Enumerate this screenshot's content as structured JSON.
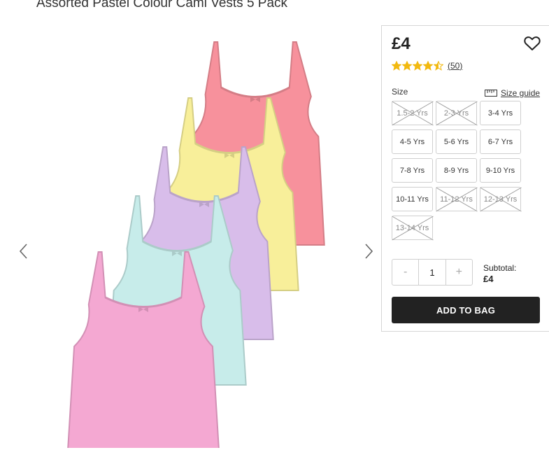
{
  "product": {
    "title": "Assorted Pastel Colour Cami Vests 5 Pack",
    "price": "£4",
    "rating": {
      "value": 4.5,
      "max": 5,
      "count": "50"
    },
    "vest_colors": [
      "#f7919c",
      "#f8ef9a",
      "#d8bdea",
      "#c7ecea",
      "#f4a8d2"
    ]
  },
  "size": {
    "label": "Size",
    "guide_label": "Size guide",
    "options": [
      {
        "label": "1.5-2 Yrs",
        "available": false
      },
      {
        "label": "2-3 Yrs",
        "available": false
      },
      {
        "label": "3-4 Yrs",
        "available": true
      },
      {
        "label": "4-5 Yrs",
        "available": true
      },
      {
        "label": "5-6 Yrs",
        "available": true
      },
      {
        "label": "6-7 Yrs",
        "available": true
      },
      {
        "label": "7-8 Yrs",
        "available": true
      },
      {
        "label": "8-9 Yrs",
        "available": true
      },
      {
        "label": "9-10 Yrs",
        "available": true
      },
      {
        "label": "10-11 Yrs",
        "available": true
      },
      {
        "label": "11-12 Yrs",
        "available": false
      },
      {
        "label": "12-13 Yrs",
        "available": false
      },
      {
        "label": "13-14 Yrs",
        "available": false
      }
    ]
  },
  "quantity": {
    "minus": "-",
    "value": "1",
    "plus": "+"
  },
  "subtotal": {
    "label": "Subtotal:",
    "value": "£4"
  },
  "add_to_bag": "ADD TO BAG",
  "icons": {
    "wishlist": "heart-icon",
    "prev": "chevron-left-icon",
    "next": "chevron-right-icon",
    "guide": "ruler-icon",
    "star": "star-icon"
  },
  "colors": {
    "button": "#222222",
    "star": "#f2b90f"
  }
}
